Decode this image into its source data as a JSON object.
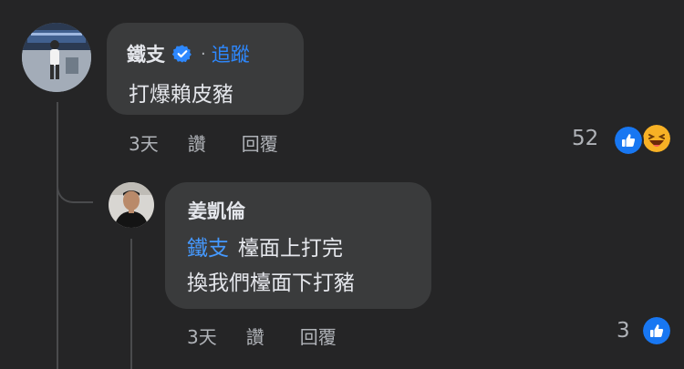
{
  "comment": {
    "author": "鐵支",
    "separator": "·",
    "follow_label": "追蹤",
    "text": "打爆賴皮豬",
    "time": "3天",
    "like_label": "讚",
    "reply_label": "回覆",
    "reaction_count": "52",
    "reactions": [
      "like-icon",
      "haha-icon"
    ],
    "verified": true
  },
  "reply": {
    "author": "姜凱倫",
    "mention": "鐵支",
    "text_line1": "檯面上打完",
    "text_line2": "換我們檯面下打豬",
    "time": "3天",
    "like_label": "讚",
    "reply_label": "回覆",
    "reaction_count": "3",
    "reactions": [
      "like-icon"
    ]
  },
  "colors": {
    "background": "#252526",
    "bubble": "#3a3b3c",
    "link": "#2d88ff",
    "secondary_text": "#b0b3b8",
    "primary_text": "#e4e6eb"
  }
}
